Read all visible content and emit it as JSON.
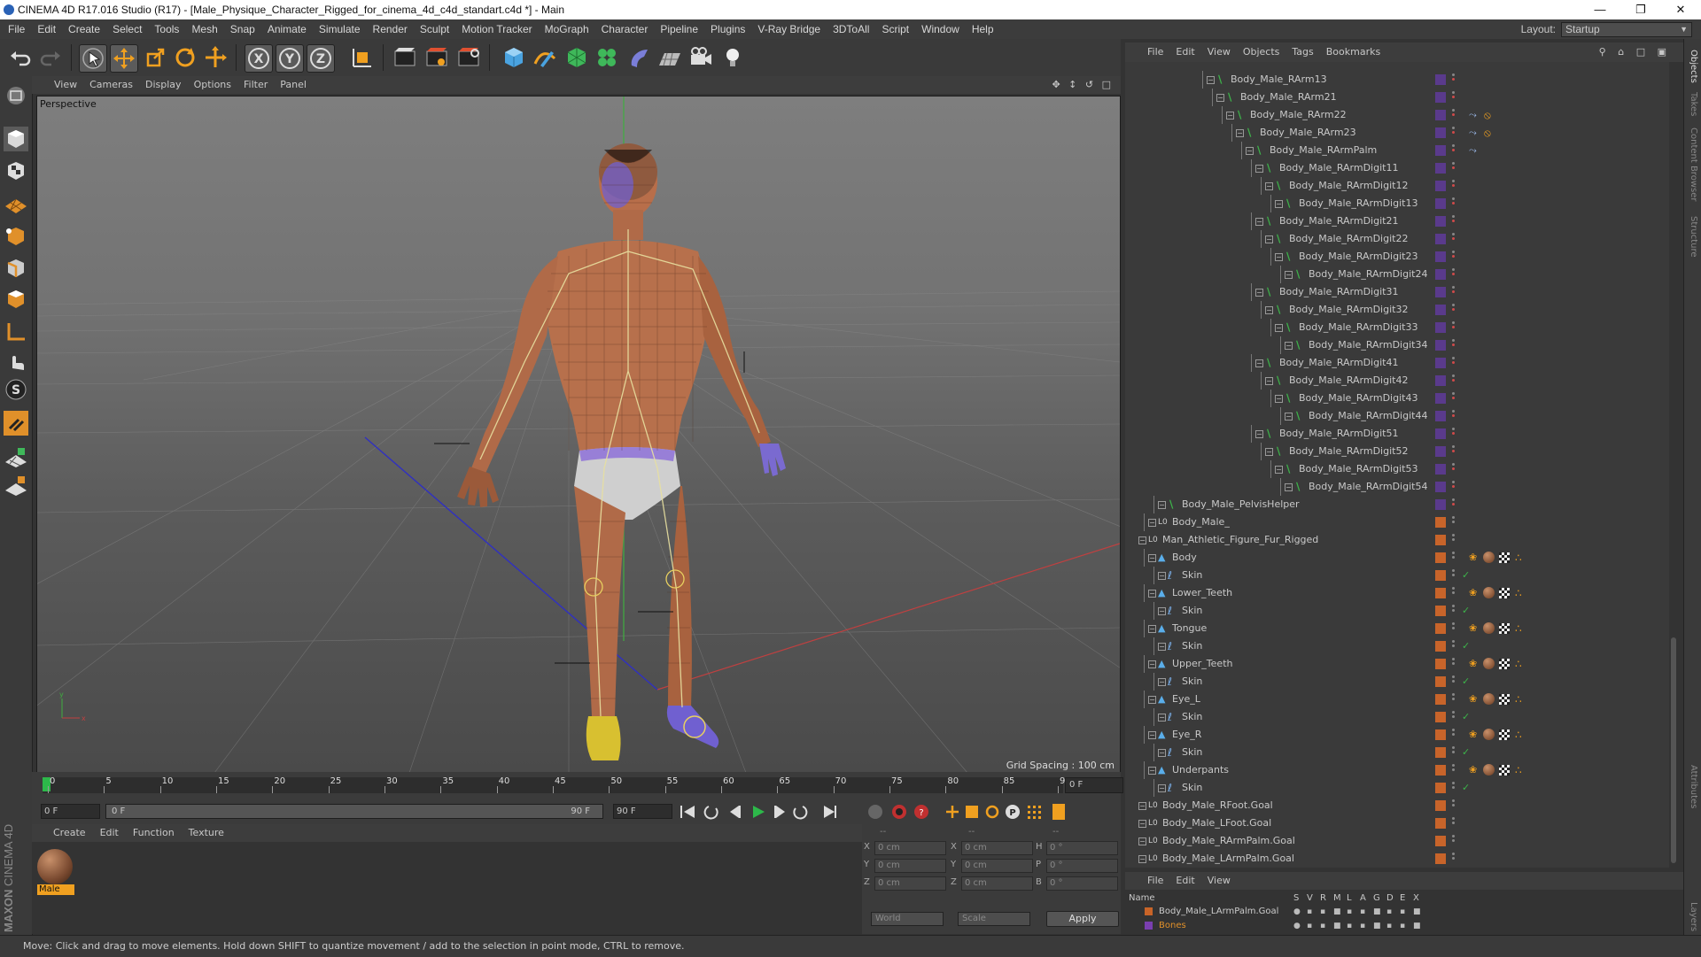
{
  "window": {
    "title": "CINEMA 4D R17.016 Studio (R17) - [Male_Physique_Character_Rigged_for_cinema_4d_c4d_standart.c4d *] - Main"
  },
  "menu": [
    "File",
    "Edit",
    "Create",
    "Select",
    "Tools",
    "Mesh",
    "Snap",
    "Animate",
    "Simulate",
    "Render",
    "Sculpt",
    "Motion Tracker",
    "MoGraph",
    "Character",
    "Pipeline",
    "Plugins",
    "V-Ray Bridge",
    "3DToAll",
    "Script",
    "Window",
    "Help"
  ],
  "layout": {
    "label": "Layout:",
    "value": "Startup"
  },
  "viewport": {
    "menu": [
      "View",
      "Cameras",
      "Display",
      "Options",
      "Filter",
      "Panel"
    ],
    "label": "Perspective",
    "grid_spacing": "Grid Spacing : 100 cm"
  },
  "timeline": {
    "ticks": [
      "0",
      "5",
      "10",
      "15",
      "20",
      "25",
      "30",
      "35",
      "40",
      "45",
      "50",
      "55",
      "60",
      "65",
      "70",
      "75",
      "80",
      "85",
      "90"
    ],
    "current_frame": "0 F",
    "start": "0 F",
    "range_start": "0 F",
    "range_end": "90 F",
    "end": "90 F"
  },
  "material_manager": {
    "menu": [
      "Create",
      "Edit",
      "Function",
      "Texture"
    ],
    "materials": [
      {
        "name": "Male"
      }
    ]
  },
  "coordinates": {
    "headers": [
      "--",
      "--",
      "--"
    ],
    "rows": [
      {
        "a": "X",
        "av": "0 cm",
        "b": "X",
        "bv": "0 cm",
        "c": "H",
        "cv": "0 °"
      },
      {
        "a": "Y",
        "av": "0 cm",
        "b": "Y",
        "bv": "0 cm",
        "c": "P",
        "cv": "0 °"
      },
      {
        "a": "Z",
        "av": "0 cm",
        "b": "Z",
        "bv": "0 cm",
        "c": "B",
        "cv": "0 °"
      }
    ],
    "world": "World",
    "scale": "Scale",
    "apply": "Apply"
  },
  "object_manager": {
    "menu": [
      "File",
      "Edit",
      "View",
      "Objects",
      "Tags",
      "Bookmarks"
    ],
    "rows": [
      {
        "name": "Body_Male_RArm13",
        "depth": 7,
        "kind": "bone",
        "tags": "none"
      },
      {
        "name": "Body_Male_RArm21",
        "depth": 8,
        "kind": "bone",
        "tags": "none"
      },
      {
        "name": "Body_Male_RArm22",
        "depth": 9,
        "kind": "bone",
        "tags": "ik"
      },
      {
        "name": "Body_Male_RArm23",
        "depth": 10,
        "kind": "bone",
        "tags": "ik"
      },
      {
        "name": "Body_Male_RArmPalm",
        "depth": 11,
        "kind": "bone",
        "tags": "ik2"
      },
      {
        "name": "Body_Male_RArmDigit11",
        "depth": 12,
        "kind": "bone",
        "tags": "none"
      },
      {
        "name": "Body_Male_RArmDigit12",
        "depth": 13,
        "kind": "bone",
        "tags": "none"
      },
      {
        "name": "Body_Male_RArmDigit13",
        "depth": 14,
        "kind": "bone",
        "tags": "none"
      },
      {
        "name": "Body_Male_RArmDigit21",
        "depth": 12,
        "kind": "bone",
        "tags": "none"
      },
      {
        "name": "Body_Male_RArmDigit22",
        "depth": 13,
        "kind": "bone",
        "tags": "none"
      },
      {
        "name": "Body_Male_RArmDigit23",
        "depth": 14,
        "kind": "bone",
        "tags": "none"
      },
      {
        "name": "Body_Male_RArmDigit24",
        "depth": 15,
        "kind": "bone",
        "tags": "none"
      },
      {
        "name": "Body_Male_RArmDigit31",
        "depth": 12,
        "kind": "bone",
        "tags": "none"
      },
      {
        "name": "Body_Male_RArmDigit32",
        "depth": 13,
        "kind": "bone",
        "tags": "none"
      },
      {
        "name": "Body_Male_RArmDigit33",
        "depth": 14,
        "kind": "bone",
        "tags": "none"
      },
      {
        "name": "Body_Male_RArmDigit34",
        "depth": 15,
        "kind": "bone",
        "tags": "none"
      },
      {
        "name": "Body_Male_RArmDigit41",
        "depth": 12,
        "kind": "bone",
        "tags": "none"
      },
      {
        "name": "Body_Male_RArmDigit42",
        "depth": 13,
        "kind": "bone",
        "tags": "none"
      },
      {
        "name": "Body_Male_RArmDigit43",
        "depth": 14,
        "kind": "bone",
        "tags": "none"
      },
      {
        "name": "Body_Male_RArmDigit44",
        "depth": 15,
        "kind": "bone",
        "tags": "none"
      },
      {
        "name": "Body_Male_RArmDigit51",
        "depth": 12,
        "kind": "bone",
        "tags": "none"
      },
      {
        "name": "Body_Male_RArmDigit52",
        "depth": 13,
        "kind": "bone",
        "tags": "none"
      },
      {
        "name": "Body_Male_RArmDigit53",
        "depth": 14,
        "kind": "bone",
        "tags": "none"
      },
      {
        "name": "Body_Male_RArmDigit54",
        "depth": 15,
        "kind": "bone",
        "tags": "none"
      },
      {
        "name": "Body_Male_PelvisHelper",
        "depth": 2,
        "kind": "bone",
        "tags": "none"
      },
      {
        "name": "Body_Male_",
        "depth": 1,
        "kind": "null",
        "tags": "none"
      },
      {
        "name": "Man_Athletic_Figure_Fur_Rigged",
        "depth": 0,
        "kind": "null",
        "tags": "none"
      },
      {
        "name": "Body",
        "depth": 1,
        "kind": "mesh",
        "tags": "mat"
      },
      {
        "name": "Skin",
        "depth": 2,
        "kind": "skin",
        "tags": "none"
      },
      {
        "name": "Lower_Teeth",
        "depth": 1,
        "kind": "mesh",
        "tags": "mat"
      },
      {
        "name": "Skin",
        "depth": 2,
        "kind": "skin",
        "tags": "none"
      },
      {
        "name": "Tongue",
        "depth": 1,
        "kind": "mesh",
        "tags": "mat"
      },
      {
        "name": "Skin",
        "depth": 2,
        "kind": "skin",
        "tags": "none"
      },
      {
        "name": "Upper_Teeth",
        "depth": 1,
        "kind": "mesh",
        "tags": "mat"
      },
      {
        "name": "Skin",
        "depth": 2,
        "kind": "skin",
        "tags": "none"
      },
      {
        "name": "Eye_L",
        "depth": 1,
        "kind": "mesh",
        "tags": "mat"
      },
      {
        "name": "Skin",
        "depth": 2,
        "kind": "skin",
        "tags": "none"
      },
      {
        "name": "Eye_R",
        "depth": 1,
        "kind": "mesh",
        "tags": "mat"
      },
      {
        "name": "Skin",
        "depth": 2,
        "kind": "skin",
        "tags": "none"
      },
      {
        "name": "Underpants",
        "depth": 1,
        "kind": "mesh",
        "tags": "mat"
      },
      {
        "name": "Skin",
        "depth": 2,
        "kind": "skin",
        "tags": "none"
      },
      {
        "name": "Body_Male_RFoot.Goal",
        "depth": 0,
        "kind": "null",
        "tags": "none"
      },
      {
        "name": "Body_Male_LFoot.Goal",
        "depth": 0,
        "kind": "null",
        "tags": "none"
      },
      {
        "name": "Body_Male_RArmPalm.Goal",
        "depth": 0,
        "kind": "null",
        "tags": "none"
      },
      {
        "name": "Body_Male_LArmPalm.Goal",
        "depth": 0,
        "kind": "null",
        "tags": "none"
      }
    ]
  },
  "layer_manager": {
    "menu": [
      "File",
      "Edit",
      "View"
    ],
    "columns": [
      "Name",
      "S",
      "V",
      "R",
      "M",
      "L",
      "A",
      "G",
      "D",
      "E",
      "X"
    ],
    "rows": [
      {
        "name": "Body_Male_LArmPalm.Goal",
        "color": "#c86428"
      },
      {
        "name": "Bones",
        "color": "#7a3fb0"
      }
    ]
  },
  "right_tabs": [
    "Objects",
    "Takes",
    "Content Browser",
    "Structure",
    "Attributes",
    "Layers"
  ],
  "status": {
    "text": "Move: Click and drag to move elements. Hold down SHIFT to quantize movement / add to the selection in point mode, CTRL to remove."
  },
  "brand": {
    "maxon": "MAXON",
    "product": "CINEMA 4D"
  },
  "colors": {
    "accent_orange": "#e07a2e",
    "tree_bone_green": "#3db34a",
    "layer_purple": "#5a3a8c"
  }
}
